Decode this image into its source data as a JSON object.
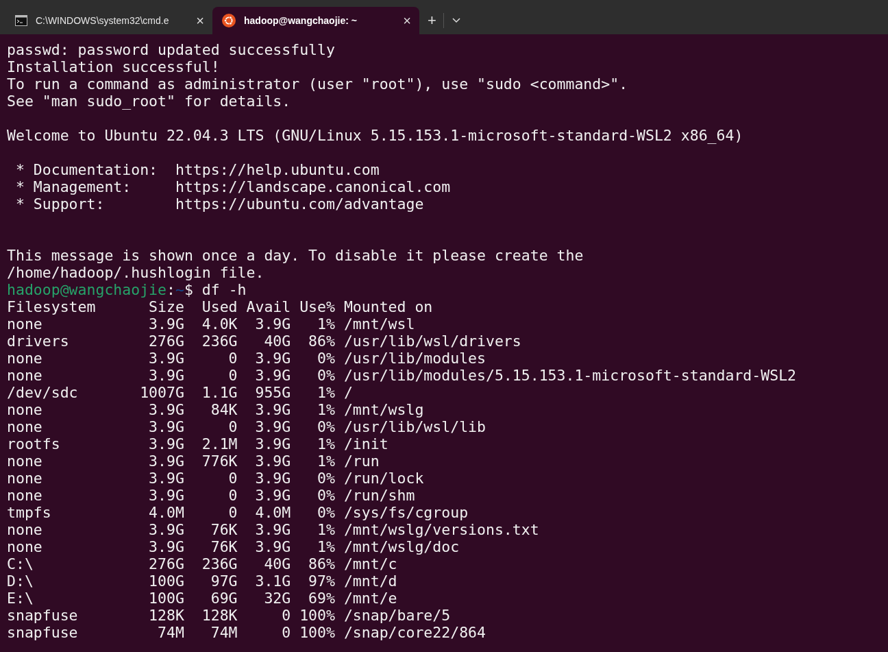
{
  "tabs": [
    {
      "title": "C:\\WINDOWS\\system32\\cmd.e",
      "kind": "cmd",
      "selected": false,
      "close": "×"
    },
    {
      "title": "hadoop@wangchaojie: ~",
      "kind": "ubuntu",
      "selected": true,
      "close": "×"
    }
  ],
  "new_tab": "+",
  "lines": [
    {
      "kind": "text",
      "text": "passwd: password updated successfully"
    },
    {
      "kind": "text",
      "text": "Installation successful!"
    },
    {
      "kind": "text",
      "text": "To run a command as administrator (user \"root\"), use \"sudo <command>\"."
    },
    {
      "kind": "text",
      "text": "See \"man sudo_root\" for details."
    },
    {
      "kind": "blank"
    },
    {
      "kind": "text",
      "text": "Welcome to Ubuntu 22.04.3 LTS (GNU/Linux 5.15.153.1-microsoft-standard-WSL2 x86_64)"
    },
    {
      "kind": "blank"
    },
    {
      "kind": "text",
      "text": " * Documentation:  https://help.ubuntu.com"
    },
    {
      "kind": "text",
      "text": " * Management:     https://landscape.canonical.com"
    },
    {
      "kind": "text",
      "text": " * Support:        https://ubuntu.com/advantage"
    },
    {
      "kind": "blank"
    },
    {
      "kind": "blank"
    },
    {
      "kind": "text",
      "text": "This message is shown once a day. To disable it please create the"
    },
    {
      "kind": "text",
      "text": "/home/hadoop/.hushlogin file."
    },
    {
      "kind": "prompt",
      "user": "hadoop@wangchaojie",
      "sep": ":",
      "path": "~",
      "command": "$ df -h"
    },
    {
      "kind": "text",
      "text": "Filesystem      Size  Used Avail Use% Mounted on"
    },
    {
      "kind": "text",
      "text": "none            3.9G  4.0K  3.9G   1% /mnt/wsl"
    },
    {
      "kind": "text",
      "text": "drivers         276G  236G   40G  86% /usr/lib/wsl/drivers"
    },
    {
      "kind": "text",
      "text": "none            3.9G     0  3.9G   0% /usr/lib/modules"
    },
    {
      "kind": "text",
      "text": "none            3.9G     0  3.9G   0% /usr/lib/modules/5.15.153.1-microsoft-standard-WSL2"
    },
    {
      "kind": "text",
      "text": "/dev/sdc       1007G  1.1G  955G   1% /"
    },
    {
      "kind": "text",
      "text": "none            3.9G   84K  3.9G   1% /mnt/wslg"
    },
    {
      "kind": "text",
      "text": "none            3.9G     0  3.9G   0% /usr/lib/wsl/lib"
    },
    {
      "kind": "text",
      "text": "rootfs          3.9G  2.1M  3.9G   1% /init"
    },
    {
      "kind": "text",
      "text": "none            3.9G  776K  3.9G   1% /run"
    },
    {
      "kind": "text",
      "text": "none            3.9G     0  3.9G   0% /run/lock"
    },
    {
      "kind": "text",
      "text": "none            3.9G     0  3.9G   0% /run/shm"
    },
    {
      "kind": "text",
      "text": "tmpfs           4.0M     0  4.0M   0% /sys/fs/cgroup"
    },
    {
      "kind": "text",
      "text": "none            3.9G   76K  3.9G   1% /mnt/wslg/versions.txt"
    },
    {
      "kind": "text",
      "text": "none            3.9G   76K  3.9G   1% /mnt/wslg/doc"
    },
    {
      "kind": "text",
      "text": "C:\\             276G  236G   40G  86% /mnt/c"
    },
    {
      "kind": "text",
      "text": "D:\\             100G   97G  3.1G  97% /mnt/d"
    },
    {
      "kind": "text",
      "text": "E:\\             100G   69G   32G  69% /mnt/e"
    },
    {
      "kind": "text",
      "text": "snapfuse        128K  128K     0 100% /snap/bare/5"
    },
    {
      "kind": "text",
      "text": "snapfuse         74M   74M     0 100% /snap/core22/864"
    }
  ]
}
